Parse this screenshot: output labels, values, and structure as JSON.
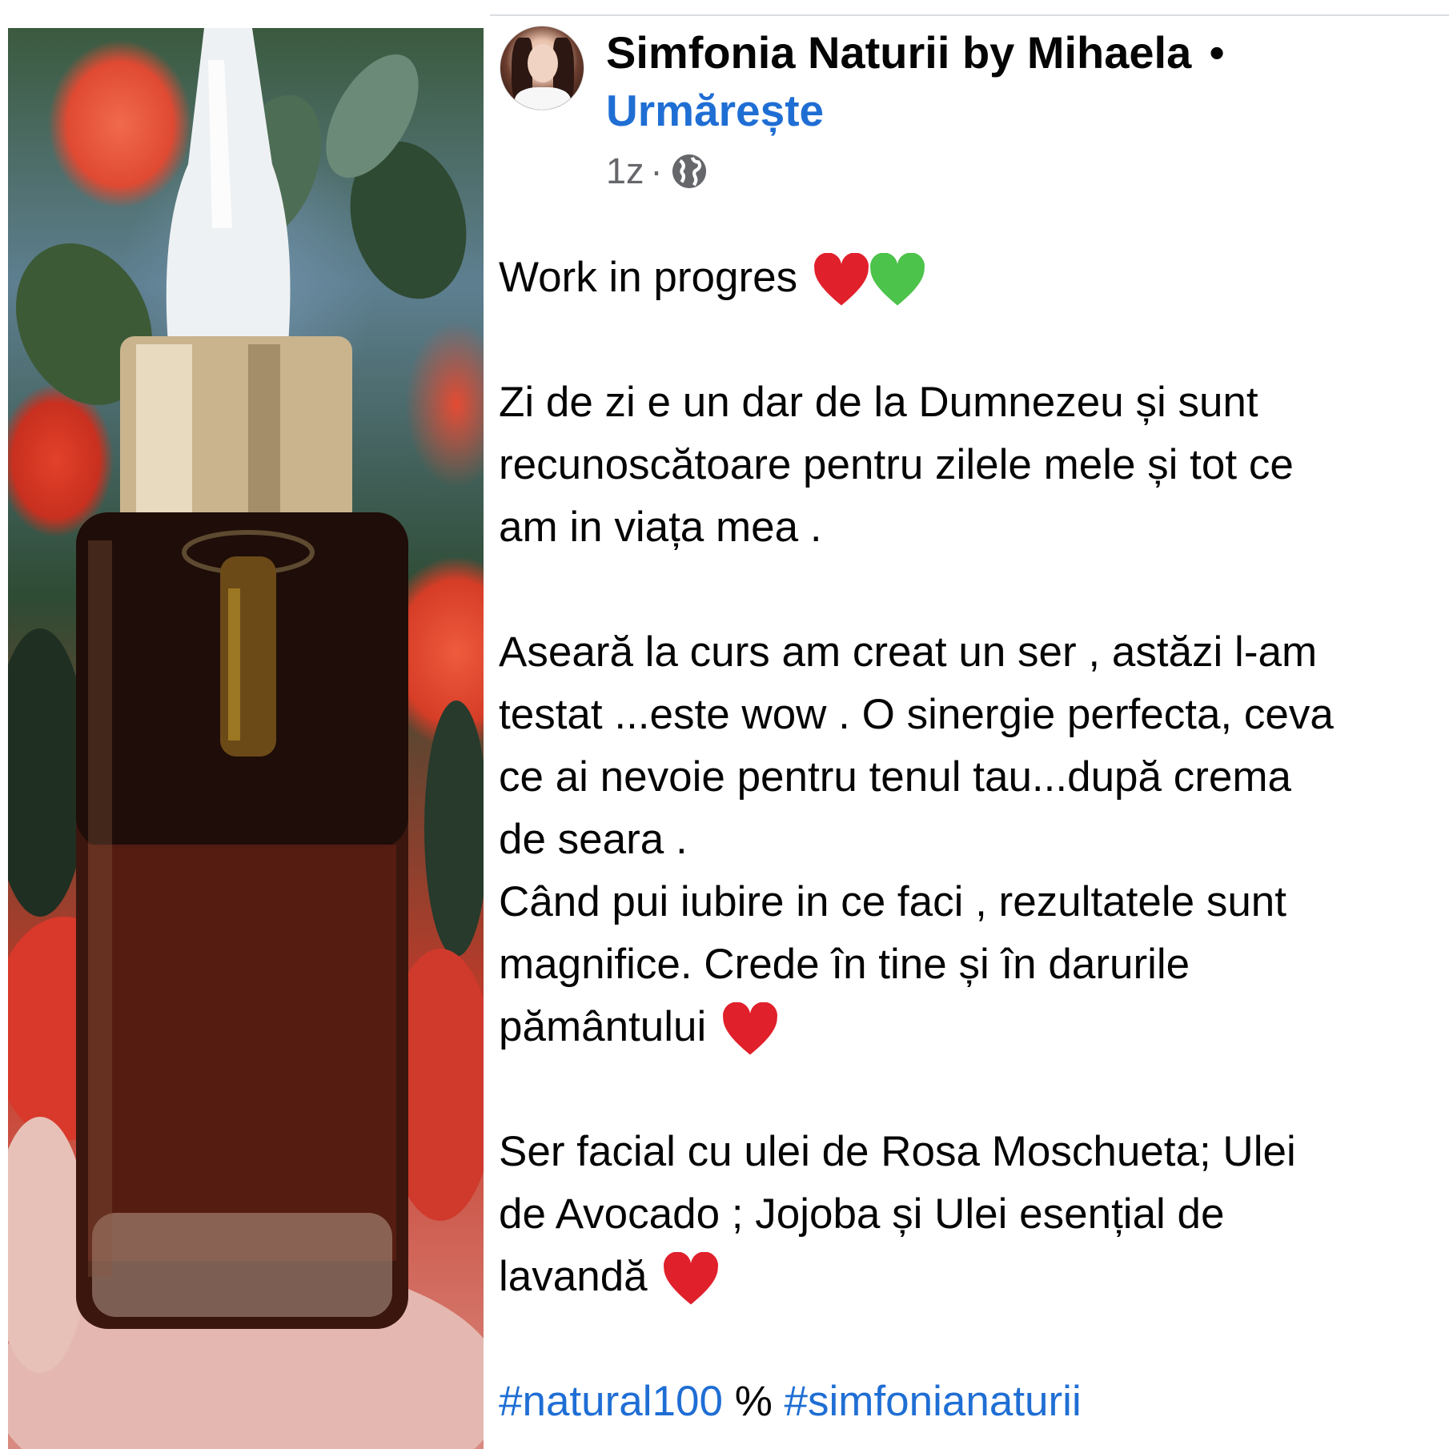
{
  "post": {
    "author": "Simfonia Naturii by Mihaela",
    "separator": "•",
    "follow_label": "Urmărește",
    "time": "1z",
    "meta_sep": "·",
    "privacy_icon": "globe-icon",
    "lines": {
      "l1": "Work in progres",
      "l2": "Zi de zi e un dar de la Dumnezeu și sunt",
      "l3": "recunoscătoare pentru zilele mele și tot ce",
      "l4": "am in viața mea .",
      "l5": "Aseară la curs am creat un ser , astăzi l-am",
      "l6": "testat ...este wow . O sinergie perfecta, ceva",
      "l7": "ce ai nevoie pentru tenul tau...după crema",
      "l8": "de seara .",
      "l9": "Când pui iubire in ce faci , rezultatele sunt",
      "l10": "magnifice. Crede în tine și în darurile",
      "l11": "pământului",
      "l12": "Ser facial cu ulei de Rosa Moschueta; Ulei",
      "l13": "de Avocado ; Jojoba și Ulei esențial de",
      "l14": "lavandă"
    },
    "hashtags": {
      "tag1": "#natural100",
      "middle": " % ",
      "tag2": "#simfonianaturii"
    },
    "emoji_colors": {
      "red_heart": "#e0202b",
      "green_heart": "#4cc34a"
    },
    "accent_color": "#1f6ed4"
  }
}
